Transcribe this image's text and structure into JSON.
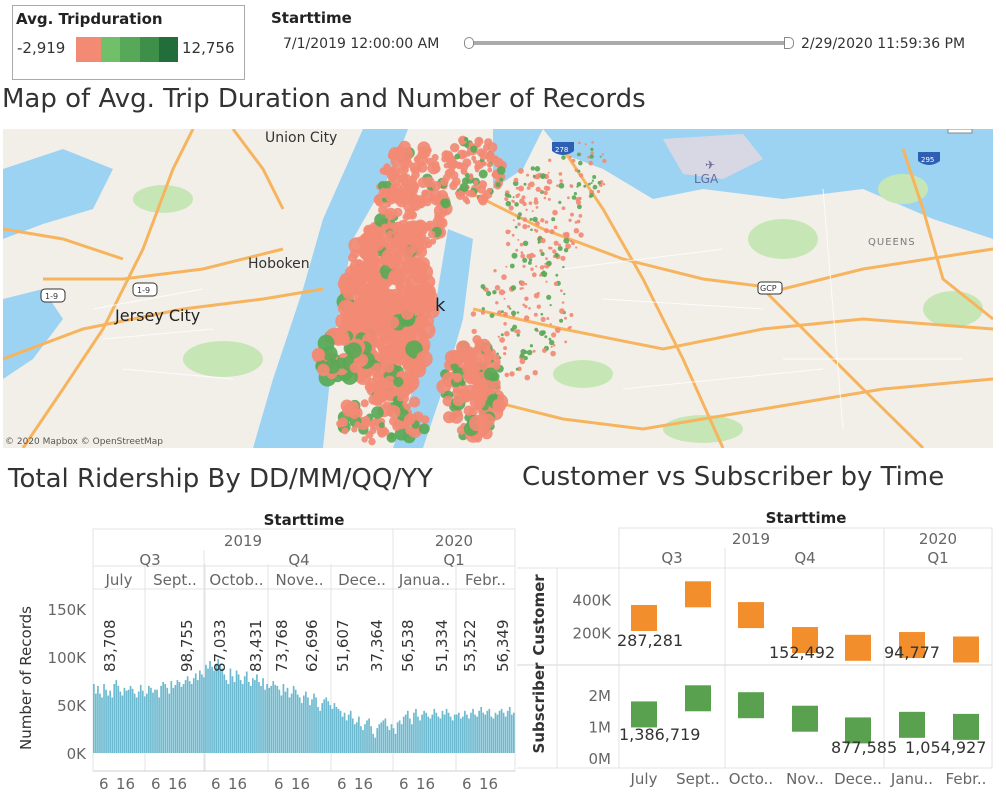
{
  "legend": {
    "title": "Avg. Tripduration",
    "min": "-2,919",
    "max": "12,756",
    "colors": [
      "#f28a74",
      "#72bf6a",
      "#58a85a",
      "#3d8f49",
      "#236d3a"
    ]
  },
  "filter": {
    "title": "Starttime",
    "start": "7/1/2019 12:00:00 AM",
    "end": "2/29/2020 11:59:36 PM"
  },
  "map": {
    "title": "Map of Avg. Trip Duration and Number of Records",
    "labels": {
      "union_city": "Union City",
      "hoboken": "Hoboken",
      "jersey_city": "Jersey City",
      "lga": "LGA",
      "queens": "QUEENS",
      "k": "k",
      "shield_278": "278",
      "shield_295": "295",
      "shield_19a": "1-9",
      "shield_19b": "1-9",
      "gcp": "GCP"
    },
    "attribution": "© 2020 Mapbox © OpenStreetMap",
    "colors": {
      "water": "#9dd3f2",
      "land": "#f2efe9",
      "park": "#c7e6b5",
      "road": "#f7b45e",
      "salmon": "#f28a74",
      "green": "#5aa956"
    }
  },
  "chart_data": [
    {
      "type": "bar",
      "title": "Total Ridership By DD/MM/QQ/YY",
      "header": "Starttime",
      "ylabel": "Number of Records",
      "ylim": [
        0,
        170000
      ],
      "yticks": [
        "0K",
        "50K",
        "100K",
        "150K"
      ],
      "years": [
        "2019",
        "2020"
      ],
      "quarters": [
        "Q3",
        "Q4",
        "Q1"
      ],
      "months": [
        "July",
        "Sept..",
        "Octob..",
        "Nove..",
        "Dece..",
        "Janua..",
        "Febr.."
      ],
      "month_totals": [
        "83,708",
        "98,755",
        "87,033",
        "83,431",
        "73,768",
        "62,696",
        "51,607",
        "37,364",
        "56,538",
        "51,334",
        "53,522",
        "56,349"
      ],
      "day_ticks": [
        "6",
        "16"
      ],
      "bar_color": "#6dbad0",
      "series": [
        {
          "values": [
            72000,
            62000,
            70000,
            62000,
            58000,
            72000,
            66000,
            60000,
            65000,
            58000,
            72000,
            76000,
            70000,
            64000,
            60000,
            68000,
            65000,
            66000,
            70000,
            67000,
            62000,
            58000,
            64000,
            71000,
            65000,
            59000,
            62000,
            70000,
            68000,
            63000,
            66000,
            66000,
            58000,
            70000,
            74000,
            72000,
            68000,
            62000,
            75000,
            68000,
            71000,
            76000,
            74000,
            69000,
            72000,
            76000,
            80000,
            75000,
            72000,
            78000,
            83000,
            76000,
            86000,
            82000,
            79000,
            92000,
            88000,
            96000,
            90000,
            86000,
            93000,
            98000,
            92000,
            88000,
            82000,
            76000,
            72000,
            88000,
            80000,
            74000,
            86000,
            82000,
            76000,
            72000,
            80000,
            85000,
            74000,
            70000,
            78000,
            76000,
            82000,
            74000,
            70000,
            78000,
            66000,
            72000,
            68000,
            70000,
            75000,
            71000,
            70000,
            66000,
            60000,
            72000,
            64000,
            68000,
            58000,
            62000,
            70000,
            66000,
            61000,
            58000,
            52000,
            60000,
            64000,
            58000,
            50000,
            56000,
            62000,
            58000,
            48000,
            44000,
            52000,
            56000,
            58000,
            54000,
            50000,
            46000,
            52000,
            48000,
            46000,
            44000,
            38000,
            42000,
            34000,
            40000,
            44000,
            36000,
            30000,
            32000,
            38000,
            28000,
            24000,
            30000,
            34000,
            36000,
            28000,
            20000,
            16000,
            26000,
            30000,
            32000,
            34000,
            36000,
            28000,
            24000,
            30000,
            26000,
            20000,
            32000,
            34000,
            30000,
            38000,
            40000,
            44000,
            36000,
            30000,
            42000,
            46000,
            38000,
            34000,
            40000,
            44000,
            42000,
            38000,
            36000,
            40000,
            46000,
            42000,
            38000,
            36000,
            44000,
            40000,
            46000,
            42000,
            38000,
            34000,
            40000,
            40000,
            42000,
            36000,
            38000,
            44000,
            40000,
            36000,
            42000,
            46000,
            40000,
            38000,
            44000,
            48000,
            42000,
            40000,
            44000,
            46000,
            38000,
            36000,
            42000,
            40000,
            44000,
            46000,
            42000,
            38000,
            44000,
            48000,
            40000,
            42000
          ]
        }
      ]
    },
    {
      "type": "scatter",
      "title": "Customer vs Subscriber by Time",
      "header": "Starttime",
      "years": [
        "2019",
        "2020"
      ],
      "quarters": [
        "Q3",
        "Q4",
        "Q1"
      ],
      "categories": [
        "July",
        "Sept..",
        "Octo..",
        "Nov..",
        "Dece..",
        "Janu..",
        "Febr.."
      ],
      "series": [
        {
          "name": "Customer",
          "color": "#f28e2b",
          "ylim": [
            0,
            550000
          ],
          "yticks": [
            "200K",
            "400K"
          ],
          "values": [
            287281,
            432000,
            305000,
            152492,
            105000,
            122000,
            94777
          ]
        },
        {
          "name": "Subscriber",
          "color": "#59a14f",
          "ylim": [
            0,
            2800000
          ],
          "yticks": [
            "0M",
            "1M",
            "2M"
          ],
          "values": [
            1386719,
            1900000,
            1680000,
            1250000,
            877585,
            1054927,
            990000
          ]
        }
      ],
      "labels": [
        "287,281",
        "152,492",
        "94,777",
        "1,386,719",
        "877,585",
        "1,054,927"
      ]
    }
  ]
}
